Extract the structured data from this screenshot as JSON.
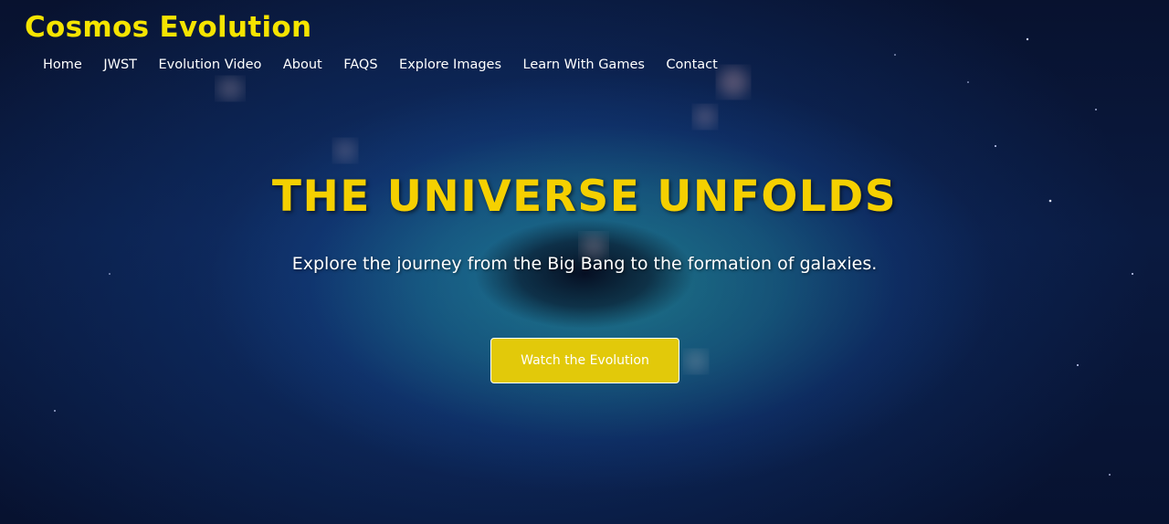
{
  "site": {
    "brand": "Cosmos Evolution"
  },
  "nav": {
    "items": [
      {
        "label": "Home"
      },
      {
        "label": "JWST"
      },
      {
        "label": "Evolution Video"
      },
      {
        "label": "About"
      },
      {
        "label": "FAQS"
      },
      {
        "label": "Explore Images"
      },
      {
        "label": "Learn With Games"
      },
      {
        "label": "Contact"
      }
    ]
  },
  "hero": {
    "headline": "THE UNIVERSE UNFOLDS",
    "subtitle": "Explore the journey from the Big Bang to the formation of galaxies.",
    "cta_label": "Watch the Evolution",
    "background": "galaxy-image"
  },
  "colors": {
    "brand": "#f5e400",
    "headline": "#f5d000",
    "cta_background": "#e2c90a",
    "cta_border": "#ffffff",
    "nav_text": "#ffffff"
  }
}
